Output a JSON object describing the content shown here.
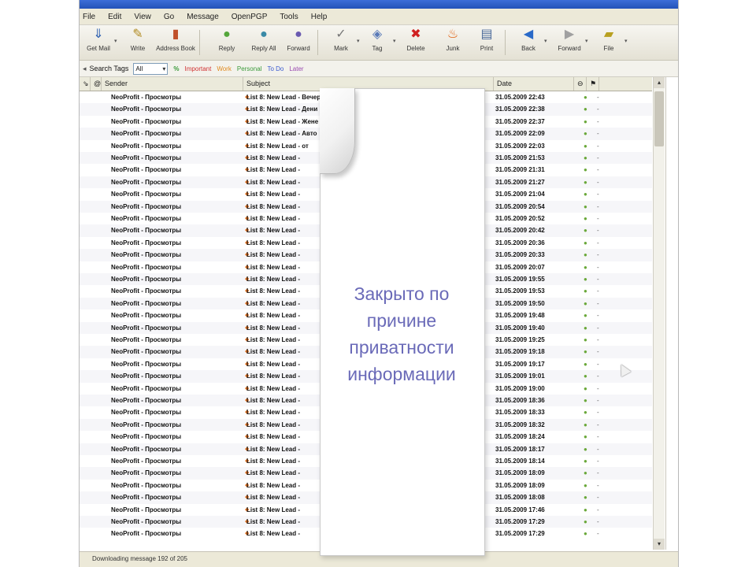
{
  "menu": [
    "File",
    "Edit",
    "View",
    "Go",
    "Message",
    "OpenPGP",
    "Tools",
    "Help"
  ],
  "toolbar": [
    {
      "label": "Get Mail",
      "icon": "get-mail-icon",
      "glyph": "⇓",
      "color": "#2c5fb0"
    },
    {
      "label": "Write",
      "icon": "write-icon",
      "glyph": "✎",
      "color": "#b08a20"
    },
    {
      "label": "Address Book",
      "icon": "address-book-icon",
      "glyph": "▮",
      "color": "#c0502a"
    },
    {
      "label": "Reply",
      "icon": "reply-icon",
      "glyph": "●",
      "color": "#54a63a"
    },
    {
      "label": "Reply All",
      "icon": "reply-all-icon",
      "glyph": "●",
      "color": "#3a8aa6"
    },
    {
      "label": "Forward",
      "icon": "forward-icon",
      "glyph": "●",
      "color": "#6a5ab0"
    },
    {
      "label": "Mark",
      "icon": "mark-icon",
      "glyph": "✓",
      "color": "#777777"
    },
    {
      "label": "Tag",
      "icon": "tag-icon",
      "glyph": "◈",
      "color": "#5a7ab8"
    },
    {
      "label": "Delete",
      "icon": "delete-icon",
      "glyph": "✖",
      "color": "#d02020"
    },
    {
      "label": "Junk",
      "icon": "junk-icon",
      "glyph": "♨",
      "color": "#e06010"
    },
    {
      "label": "Print",
      "icon": "print-icon",
      "glyph": "▤",
      "color": "#4a6a9a"
    },
    {
      "label": "Back",
      "icon": "back-icon",
      "glyph": "◀",
      "color": "#2a6ac8"
    },
    {
      "label": "Forward",
      "icon": "forward-nav-icon",
      "glyph": "▶",
      "color": "#a0a0a0"
    },
    {
      "label": "File",
      "icon": "file-icon",
      "glyph": "▰",
      "color": "#b8a020"
    }
  ],
  "filter": {
    "search_tags_label": "Search Tags",
    "tag_value": "All",
    "tags": [
      {
        "label": "Important",
        "color": "#d03030"
      },
      {
        "label": "Work",
        "color": "#e08a20"
      },
      {
        "label": "Personal",
        "color": "#3a9a3a"
      },
      {
        "label": "To Do",
        "color": "#3a5ad0"
      },
      {
        "label": "Later",
        "color": "#9a4ab0"
      }
    ]
  },
  "columns": {
    "sender": "Sender",
    "subject": "Subject",
    "date": "Date"
  },
  "rows": [
    {
      "sender": "NeoProfit - Просмотры",
      "subject": "List 8: New Lead - Вечер",
      "date": "31.05.2009 22:43"
    },
    {
      "sender": "NeoProfit - Просмотры",
      "subject": "List 8: New Lead - Дени",
      "date": "31.05.2009 22:38"
    },
    {
      "sender": "NeoProfit - Просмотры",
      "subject": "List 8: New Lead - Жене",
      "date": "31.05.2009 22:37"
    },
    {
      "sender": "NeoProfit - Просмотры",
      "subject": "List 8: New Lead - Авто",
      "date": "31.05.2009 22:09"
    },
    {
      "sender": "NeoProfit - Просмотры",
      "subject": "List 8: New Lead - от",
      "date": "31.05.2009 22:03"
    },
    {
      "sender": "NeoProfit - Просмотры",
      "subject": "List 8: New Lead -",
      "date": "31.05.2009 21:53"
    },
    {
      "sender": "NeoProfit - Просмотры",
      "subject": "List 8: New Lead -",
      "date": "31.05.2009 21:31"
    },
    {
      "sender": "NeoProfit - Просмотры",
      "subject": "List 8: New Lead -",
      "date": "31.05.2009 21:27"
    },
    {
      "sender": "NeoProfit - Просмотры",
      "subject": "List 8: New Lead -",
      "date": "31.05.2009 21:04"
    },
    {
      "sender": "NeoProfit - Просмотры",
      "subject": "List 8: New Lead -",
      "date": "31.05.2009 20:54"
    },
    {
      "sender": "NeoProfit - Просмотры",
      "subject": "List 8: New Lead -",
      "date": "31.05.2009 20:52"
    },
    {
      "sender": "NeoProfit - Просмотры",
      "subject": "List 8: New Lead -",
      "date": "31.05.2009 20:42"
    },
    {
      "sender": "NeoProfit - Просмотры",
      "subject": "List 8: New Lead -",
      "date": "31.05.2009 20:36"
    },
    {
      "sender": "NeoProfit - Просмотры",
      "subject": "List 8: New Lead -",
      "date": "31.05.2009 20:33"
    },
    {
      "sender": "NeoProfit - Просмотры",
      "subject": "List 8: New Lead -",
      "date": "31.05.2009 20:07"
    },
    {
      "sender": "NeoProfit - Просмотры",
      "subject": "List 8: New Lead -",
      "date": "31.05.2009 19:55"
    },
    {
      "sender": "NeoProfit - Просмотры",
      "subject": "List 8: New Lead -",
      "date": "31.05.2009 19:53"
    },
    {
      "sender": "NeoProfit - Просмотры",
      "subject": "List 8: New Lead -",
      "date": "31.05.2009 19:50"
    },
    {
      "sender": "NeoProfit - Просмотры",
      "subject": "List 8: New Lead -",
      "date": "31.05.2009 19:48"
    },
    {
      "sender": "NeoProfit - Просмотры",
      "subject": "List 8: New Lead -",
      "date": "31.05.2009 19:40"
    },
    {
      "sender": "NeoProfit - Просмотры",
      "subject": "List 8: New Lead -",
      "date": "31.05.2009 19:25"
    },
    {
      "sender": "NeoProfit - Просмотры",
      "subject": "List 8: New Lead -",
      "date": "31.05.2009 19:18"
    },
    {
      "sender": "NeoProfit - Просмотры",
      "subject": "List 8: New Lead -",
      "date": "31.05.2009 19:17"
    },
    {
      "sender": "NeoProfit - Просмотры",
      "subject": "List 8: New Lead -",
      "date": "31.05.2009 19:01"
    },
    {
      "sender": "NeoProfit - Просмотры",
      "subject": "List 8: New Lead -",
      "date": "31.05.2009 19:00"
    },
    {
      "sender": "NeoProfit - Просмотры",
      "subject": "List 8: New Lead -",
      "date": "31.05.2009 18:36"
    },
    {
      "sender": "NeoProfit - Просмотры",
      "subject": "List 8: New Lead -",
      "date": "31.05.2009 18:33"
    },
    {
      "sender": "NeoProfit - Просмотры",
      "subject": "List 8: New Lead -",
      "date": "31.05.2009 18:32"
    },
    {
      "sender": "NeoProfit - Просмотры",
      "subject": "List 8: New Lead -",
      "date": "31.05.2009 18:24"
    },
    {
      "sender": "NeoProfit - Просмотры",
      "subject": "List 8: New Lead -",
      "date": "31.05.2009 18:17"
    },
    {
      "sender": "NeoProfit - Просмотры",
      "subject": "List 8: New Lead -",
      "date": "31.05.2009 18:14"
    },
    {
      "sender": "NeoProfit - Просмотры",
      "subject": "List 8: New Lead -",
      "date": "31.05.2009 18:09"
    },
    {
      "sender": "NeoProfit - Просмотры",
      "subject": "List 8: New Lead -",
      "date": "31.05.2009 18:09"
    },
    {
      "sender": "NeoProfit - Просмотры",
      "subject": "List 8: New Lead -",
      "date": "31.05.2009 18:08"
    },
    {
      "sender": "NeoProfit - Просмотры",
      "subject": "List 8: New Lead -",
      "date": "31.05.2009 17:46"
    },
    {
      "sender": "NeoProfit - Просмотры",
      "subject": "List 8: New Lead -",
      "date": "31.05.2009 17:29"
    },
    {
      "sender": "NeoProfit - Просмотры",
      "subject": "List 8: New Lead -",
      "date": "31.05.2009 17:29"
    }
  ],
  "overlay": {
    "lines": [
      "Закрыто по",
      "причине",
      "приватности",
      "информации"
    ]
  },
  "status": {
    "text": "Downloading message 192 of 205"
  },
  "colors": {
    "overlay_text": "#6a6ab8",
    "junk_dot": "#6aa83a"
  }
}
